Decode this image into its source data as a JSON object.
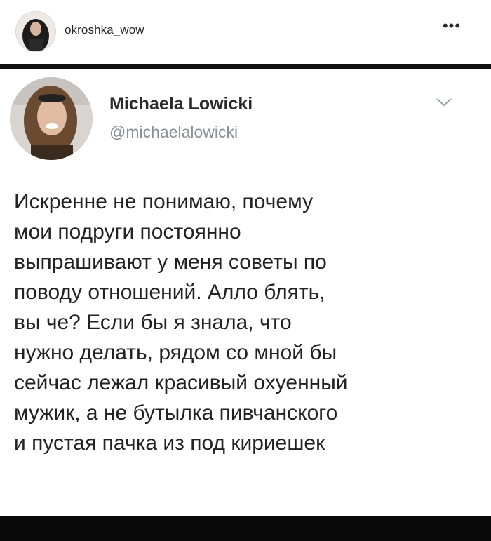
{
  "instagram_header": {
    "username": "okroshka_wow",
    "more_label": "•••",
    "avatar_icon": "profile-photo-icon"
  },
  "tweet": {
    "display_name": "Michaela Lowicki",
    "handle": "@michaelalowicki",
    "chevron_icon": "chevron-down-icon",
    "text_lines": [
      "Искренне не понимаю, почему",
      "мои подруги постоянно",
      "выпрашивают у меня советы по",
      "поводу отношений. Алло блять,",
      "вы че? Если бы я знала, что",
      "нужно делать, рядом со мной бы",
      "сейчас лежал красивый охуенный",
      "мужик, а не бутылка пивчанского",
      "и пустая пачка из под кириешек"
    ]
  },
  "colors": {
    "name": "#2a2a2a",
    "handle": "#8a9096",
    "text": "#222222",
    "divider": "#111111"
  }
}
